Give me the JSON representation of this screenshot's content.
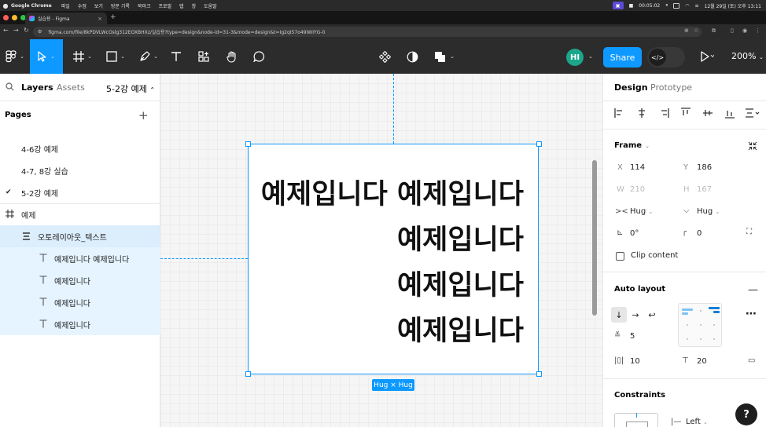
{
  "menubar": {
    "app_name": "Google Chrome",
    "items": [
      "파일",
      "수정",
      "보기",
      "방문 기록",
      "북마크",
      "프로필",
      "탭",
      "창",
      "도움말"
    ],
    "recording_time": "00:05:02",
    "datetime": "12월 29일 (토) 오후 13:11"
  },
  "browser": {
    "tab_title": "실습용 - Figma",
    "url": "figma.com/file/8kPDVLWcOslg312EOXBHXz/실습용?type=design&node-id=31-3&mode=design&t=Ig2qI57o49IWIYG-0"
  },
  "toolbar": {
    "share_label": "Share",
    "avatar_initials": "HI",
    "zoom": "200%",
    "devmode_icon": "</>"
  },
  "left_panel": {
    "tab_layers": "Layers",
    "tab_assets": "Assets",
    "current_page": "5-2강 예제",
    "pages_heading": "Pages",
    "pages": [
      {
        "label": "4-6강 예제",
        "checked": false
      },
      {
        "label": "4-7, 8강 실습",
        "checked": false
      },
      {
        "label": "5-2강 예제",
        "checked": true
      }
    ],
    "layers": [
      {
        "label": "예제",
        "icon": "frame-icon"
      },
      {
        "label": "오토레이아웃_텍스트",
        "icon": "autolayout-icon"
      },
      {
        "label": "예제입니다 예제입니다",
        "icon": "text-icon"
      },
      {
        "label": "예제입니다",
        "icon": "text-icon"
      },
      {
        "label": "예제입니다",
        "icon": "text-icon"
      },
      {
        "label": "예제입니다",
        "icon": "text-icon"
      }
    ]
  },
  "canvas": {
    "lines": [
      "예제입니다 예제입니다",
      "예제입니다",
      "예제입니다",
      "예제입니다"
    ],
    "size_label": "Hug × Hug",
    "accent": "#0d99ff"
  },
  "right_panel": {
    "tab_design": "Design",
    "tab_prototype": "Prototype",
    "frame_title": "Frame",
    "x_label": "X",
    "x_value": "114",
    "y_label": "Y",
    "y_value": "186",
    "w_label": "W",
    "w_value": "210",
    "h_label": "H",
    "h_value": "167",
    "width_mode": "Hug",
    "height_mode": "Hug",
    "rotation": "0°",
    "radius": "0",
    "clip_content": "Clip content",
    "auto_layout_title": "Auto layout",
    "gap": "5",
    "padding_h": "10",
    "padding_v": "20",
    "constraints_title": "Constraints",
    "constraint_h": "Left"
  }
}
